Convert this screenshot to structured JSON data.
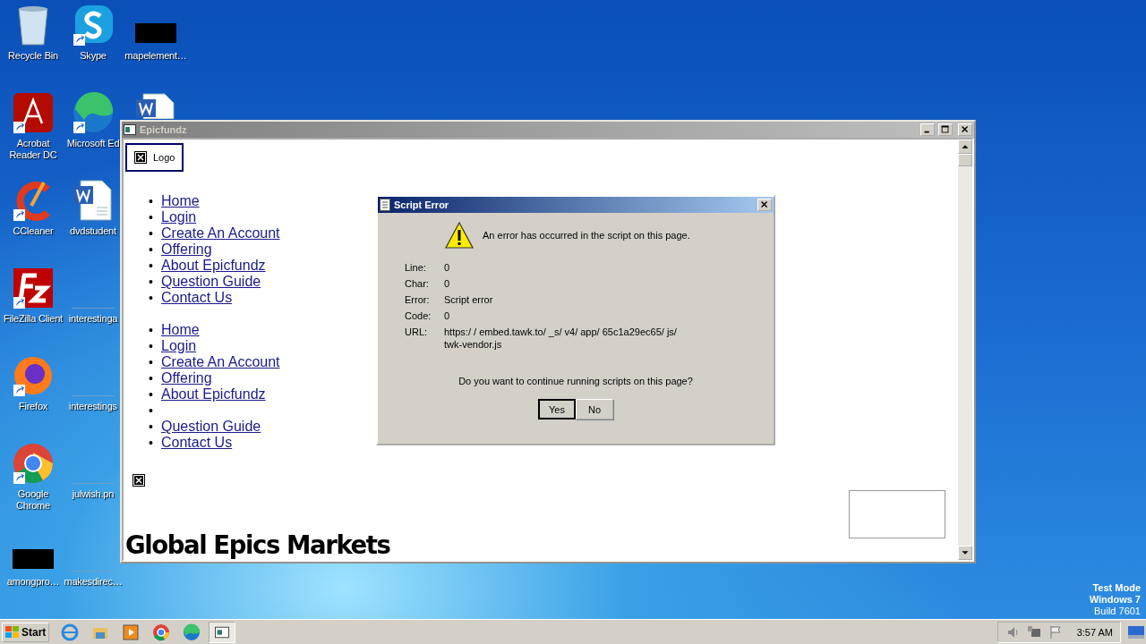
{
  "desktop_icons": [
    {
      "kind": "recycle",
      "label": "Recycle Bin"
    },
    {
      "kind": "acrobat",
      "label": "Acrobat Reader DC"
    },
    {
      "kind": "ccleaner",
      "label": "CCleaner"
    },
    {
      "kind": "filezilla",
      "label": "FileZilla Client"
    },
    {
      "kind": "firefox",
      "label": "Firefox"
    },
    {
      "kind": "chrome",
      "label": "Google Chrome"
    },
    {
      "kind": "blackbox",
      "label": "amongpro…"
    },
    {
      "kind": "skype",
      "label": "Skype"
    },
    {
      "kind": "edge",
      "label": "Microsoft Ed"
    },
    {
      "kind": "word",
      "label": "dvdstudent"
    },
    {
      "kind": "file",
      "label": "interestinga"
    },
    {
      "kind": "file",
      "label": "interestings"
    },
    {
      "kind": "file",
      "label": "julwish.pn"
    },
    {
      "kind": "file",
      "label": "makesdirec…"
    },
    {
      "kind": "blackbox",
      "label": "mapelement…"
    },
    {
      "kind": "word-cut"
    }
  ],
  "browser_window": {
    "title": "Epicfundz",
    "logo": "Logo",
    "nav_lists": [
      [
        {
          "kind": "link",
          "bullet": "•",
          "label": "Home"
        },
        {
          "kind": "link",
          "bullet": "•",
          "label": "Login"
        },
        {
          "kind": "link",
          "bullet": "•",
          "label": "Create An Account"
        },
        {
          "kind": "link",
          "bullet": "•",
          "label": "Offering"
        },
        {
          "kind": "link",
          "bullet": "•",
          "label": "About Epicfundz"
        },
        {
          "kind": "link",
          "bullet": "•",
          "label": "Question Guide"
        },
        {
          "kind": "link",
          "bullet": "•",
          "label": "Contact Us"
        }
      ],
      [
        {
          "kind": "link",
          "bullet": "•",
          "label": "Home"
        },
        {
          "kind": "link",
          "bullet": "•",
          "label": "Login"
        },
        {
          "kind": "link",
          "bullet": "•",
          "label": "Create An Account"
        },
        {
          "kind": "link",
          "bullet": "•",
          "label": "Offering"
        },
        {
          "kind": "link",
          "bullet": "•",
          "label": "About Epicfundz"
        },
        {
          "kind": "blank",
          "bullet": "•"
        },
        {
          "kind": "link",
          "bullet": "•",
          "label": "Question Guide"
        },
        {
          "kind": "link",
          "bullet": "•",
          "label": "Contact Us"
        }
      ]
    ],
    "heading": "Global Epics Markets"
  },
  "dialog": {
    "title": "Script Error",
    "message": "An error has occurred in the script on this page.",
    "fields": [
      {
        "label": "Line:",
        "value": "0"
      },
      {
        "label": "Char:",
        "value": "0"
      },
      {
        "label": "Error:",
        "value": "Script error"
      },
      {
        "label": "Code:",
        "value": "0"
      },
      {
        "label": "URL:",
        "value": "https:/ / embed.tawk.to/ _s/ v4/ app/ 65c1a29ec65/ js/ twk-vendor.js"
      }
    ],
    "question": "Do you want to continue running scripts on this page?",
    "buttons": [
      {
        "label": "Yes",
        "default": true
      },
      {
        "label": "No",
        "default": false
      }
    ]
  },
  "watermark_os": {
    "line1": "Test Mode",
    "line2": "Windows 7",
    "line3": "Build 7601"
  },
  "taskbar": {
    "start": "Start",
    "quick_launch": [
      {
        "kind": "ie"
      },
      {
        "kind": "explorer"
      },
      {
        "kind": "media"
      },
      {
        "kind": "chrome"
      },
      {
        "kind": "edge"
      }
    ],
    "window_buttons": [
      {
        "selected": true
      }
    ],
    "clock": "3:57 AM"
  }
}
